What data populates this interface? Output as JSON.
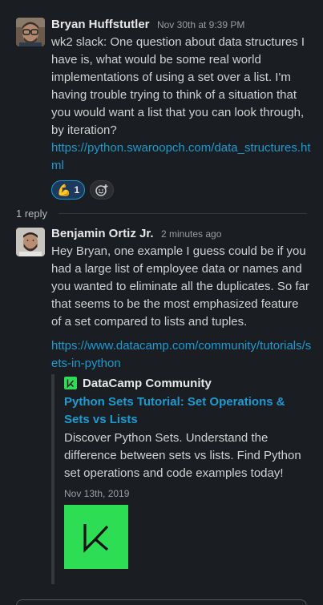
{
  "messages": [
    {
      "author": "Bryan Huffstutler",
      "timestamp": "Nov 30th at 9:39 PM",
      "text": "wk2 slack: One question about data structures I have is, what would be some real world implementations of using a set over a list. I'm having trouble trying to think of a situation that you would want a list that you can look through, by iteration?",
      "link": "https://python.swaroopch.com/data_structures.html",
      "reactions": [
        {
          "emoji": "💪",
          "count": "1"
        }
      ]
    },
    {
      "author": "Benjamin Ortiz Jr.",
      "timestamp": "2 minutes ago",
      "text": "Hey Bryan, one example I guess could be if you had a large list of employee data or names and you wanted to eliminate all the duplicates. So far that seems to be the most emphasized feature of a set compared to lists and tuples.",
      "link": "https://www.datacamp.com/community/tutorials/sets-in-python",
      "unfurl": {
        "site": "DataCamp Community",
        "title": "Python Sets Tutorial: Set Operations & Sets vs Lists",
        "description": "Discover Python Sets. Understand the difference between sets vs lists. Find Python set operations and code examples today!",
        "date": "Nov 13th, 2019"
      }
    }
  ],
  "thread": {
    "reply_count": "1 reply"
  },
  "icons": {
    "add_reaction": "add-reaction-icon",
    "site_logo": "datacamp-logo-icon"
  },
  "colors": {
    "background": "#1a1d21",
    "link": "#1d9bd1",
    "reaction_bg": "#1b3a5e",
    "brand_green": "#2ddd54"
  }
}
